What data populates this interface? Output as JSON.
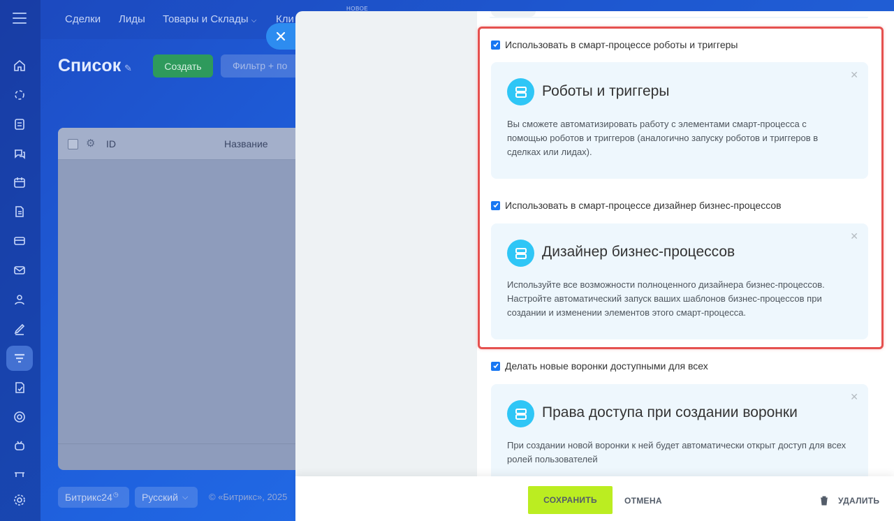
{
  "app": {
    "topnav": {
      "items": [
        "Сделки",
        "Лиды",
        "Товары и Склады",
        "Кли"
      ],
      "new_tag": "НОВОЕ"
    },
    "page": {
      "title": "Список",
      "create_label": "Создать",
      "filter_placeholder": "Фильтр + по"
    },
    "grid": {
      "columns": [
        "ID",
        "Название"
      ]
    },
    "footer": {
      "brand": "Битрикс24",
      "brand_icon": "clock-icon",
      "language": "Русский",
      "copyright": "© «Битрикс», 2025"
    },
    "sidebar_icons": [
      "home-icon",
      "process-icon",
      "tasks-icon",
      "chat-icon",
      "calendar-icon",
      "document-icon",
      "card-icon",
      "mail-icon",
      "contacts-icon",
      "sign-icon",
      "funnel-icon",
      "report-icon",
      "goal-icon",
      "bot-icon",
      "shop-icon",
      "settings-icon"
    ]
  },
  "panel": {
    "options": [
      {
        "label": "Использовать в смарт-процессе роботы и триггеры",
        "checked": true,
        "card": {
          "title": "Роботы и триггеры",
          "text": "Вы сможете автоматизировать работу с элементами смарт-процесса с помощью роботов и триггеров (аналогично запуску роботов и триггеров в сделках или лидах).",
          "icon": "layers-icon"
        }
      },
      {
        "label": "Использовать в смарт-процессе дизайнер бизнес-процессов",
        "checked": true,
        "card": {
          "title": "Дизайнер бизнес-процессов",
          "text": "Используйте все возможности полноценного дизайнера бизнес-процессов. Настройте автоматический запуск ваших шаблонов бизнес-процессов при создании и изменении элементов этого смарт-процесса.",
          "icon": "layers-icon"
        }
      },
      {
        "label": "Делать новые воронки доступными для всех",
        "checked": true,
        "card": {
          "title": "Права доступа при создании воронки",
          "text": "При создании новой воронки к ней будет автоматически открыт доступ для всех ролей пользователей",
          "icon": "layers-icon"
        }
      }
    ],
    "buttons": {
      "save": "СОХРАНИТЬ",
      "cancel": "ОТМЕНА",
      "delete": "УДАЛИТЬ"
    }
  },
  "colors": {
    "accent": "#2fc6f6",
    "checkbox": "#1877f2",
    "save_button": "#bbed21",
    "highlight": "#e5514f"
  }
}
